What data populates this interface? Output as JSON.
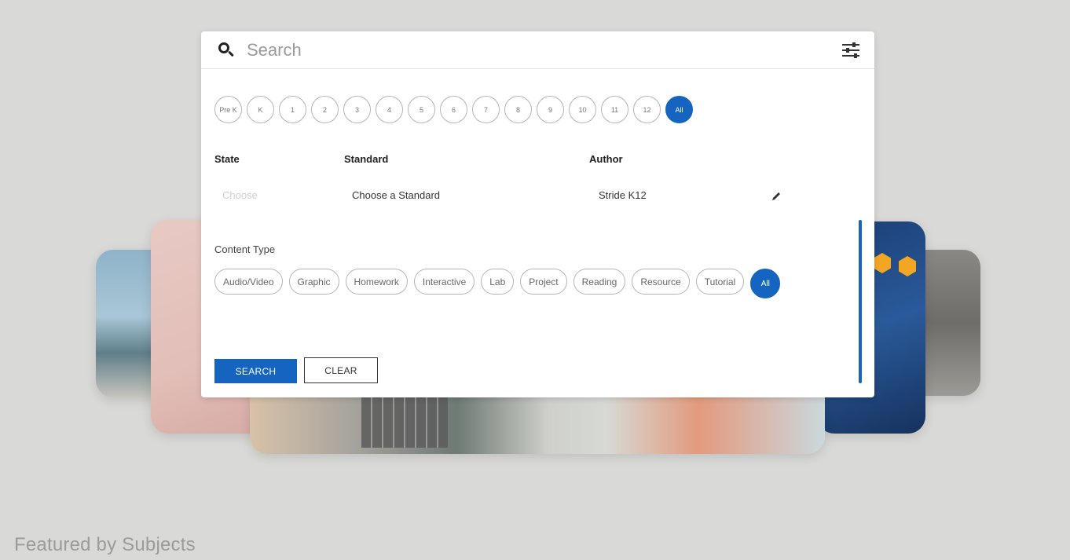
{
  "search": {
    "placeholder": "Search"
  },
  "grades": [
    {
      "label": "Pre K"
    },
    {
      "label": "K"
    },
    {
      "label": "1"
    },
    {
      "label": "2"
    },
    {
      "label": "3"
    },
    {
      "label": "4"
    },
    {
      "label": "5"
    },
    {
      "label": "6"
    },
    {
      "label": "7"
    },
    {
      "label": "8"
    },
    {
      "label": "9"
    },
    {
      "label": "10"
    },
    {
      "label": "11"
    },
    {
      "label": "12"
    },
    {
      "label": "All",
      "selected": true
    }
  ],
  "filters": {
    "state": {
      "label": "State",
      "value": "Choose"
    },
    "standard": {
      "label": "Standard",
      "value": "Choose a Standard"
    },
    "author": {
      "label": "Author",
      "value": "Stride K12"
    }
  },
  "content_type": {
    "label": "Content Type",
    "options": [
      "Audio/Video",
      "Graphic",
      "Homework",
      "Interactive",
      "Lab",
      "Project",
      "Reading",
      "Resource",
      "Tutorial",
      "All"
    ],
    "selected": "All"
  },
  "actions": {
    "search": "SEARCH",
    "clear": "CLEAR"
  },
  "footer": {
    "featured_heading": "Featured by Subjects"
  },
  "colors": {
    "accent": "#1565c0",
    "background": "#d9d9d7"
  },
  "icons": {
    "search": "search-icon",
    "filter": "filter-sliders-icon",
    "edit": "pencil-icon"
  }
}
